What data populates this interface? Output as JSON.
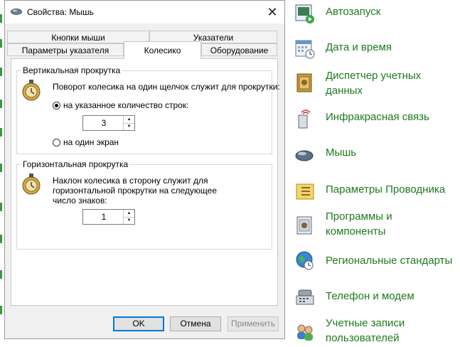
{
  "dialog": {
    "title": "Свойства: Мышь",
    "tabs": {
      "row_back": [
        "Кнопки мыши",
        "Указатели"
      ],
      "row_front": [
        "Параметры указателя",
        "Колесико",
        "Оборудование"
      ],
      "active": "Колесико"
    },
    "vertical": {
      "group_label": "Вертикальная прокрутка",
      "description": "Поворот колесика на один щелчок служит для прокрутки:",
      "option_lines": "на указанное количество строк:",
      "lines_value": "3",
      "option_screen": "на один экран",
      "selected": "lines"
    },
    "horizontal": {
      "group_label": "Горизонтальная прокрутка",
      "description_line1": "Наклон колесика в сторону служит для",
      "description_line2": "горизонтальной прокрутки на следующее",
      "description_line3": "число знаков:",
      "chars_value": "1"
    },
    "buttons": {
      "ok": "OK",
      "cancel": "Отмена",
      "apply": "Применить"
    }
  },
  "control_panel": {
    "items": [
      {
        "label": "Автозапуск",
        "icon": "autoplay-icon"
      },
      {
        "label": "Дата и время",
        "icon": "calendar-clock-icon"
      },
      {
        "label": "Диспетчер учетных",
        "label2": "данных",
        "icon": "credential-vault-icon"
      },
      {
        "label": "Инфракрасная связь",
        "icon": "infrared-icon"
      },
      {
        "label": "Мышь",
        "icon": "mouse-icon"
      },
      {
        "label": "Параметры Проводника",
        "icon": "folder-options-icon"
      },
      {
        "label": "Программы и",
        "label2": "компоненты",
        "icon": "programs-icon"
      },
      {
        "label": "Региональные стандарты",
        "icon": "globe-clock-icon"
      },
      {
        "label": "Телефон и модем",
        "icon": "phone-modem-icon"
      },
      {
        "label": "Учетные записи",
        "label2": "пользователей",
        "icon": "user-accounts-icon"
      }
    ],
    "label_color": "#1d7a1d"
  }
}
